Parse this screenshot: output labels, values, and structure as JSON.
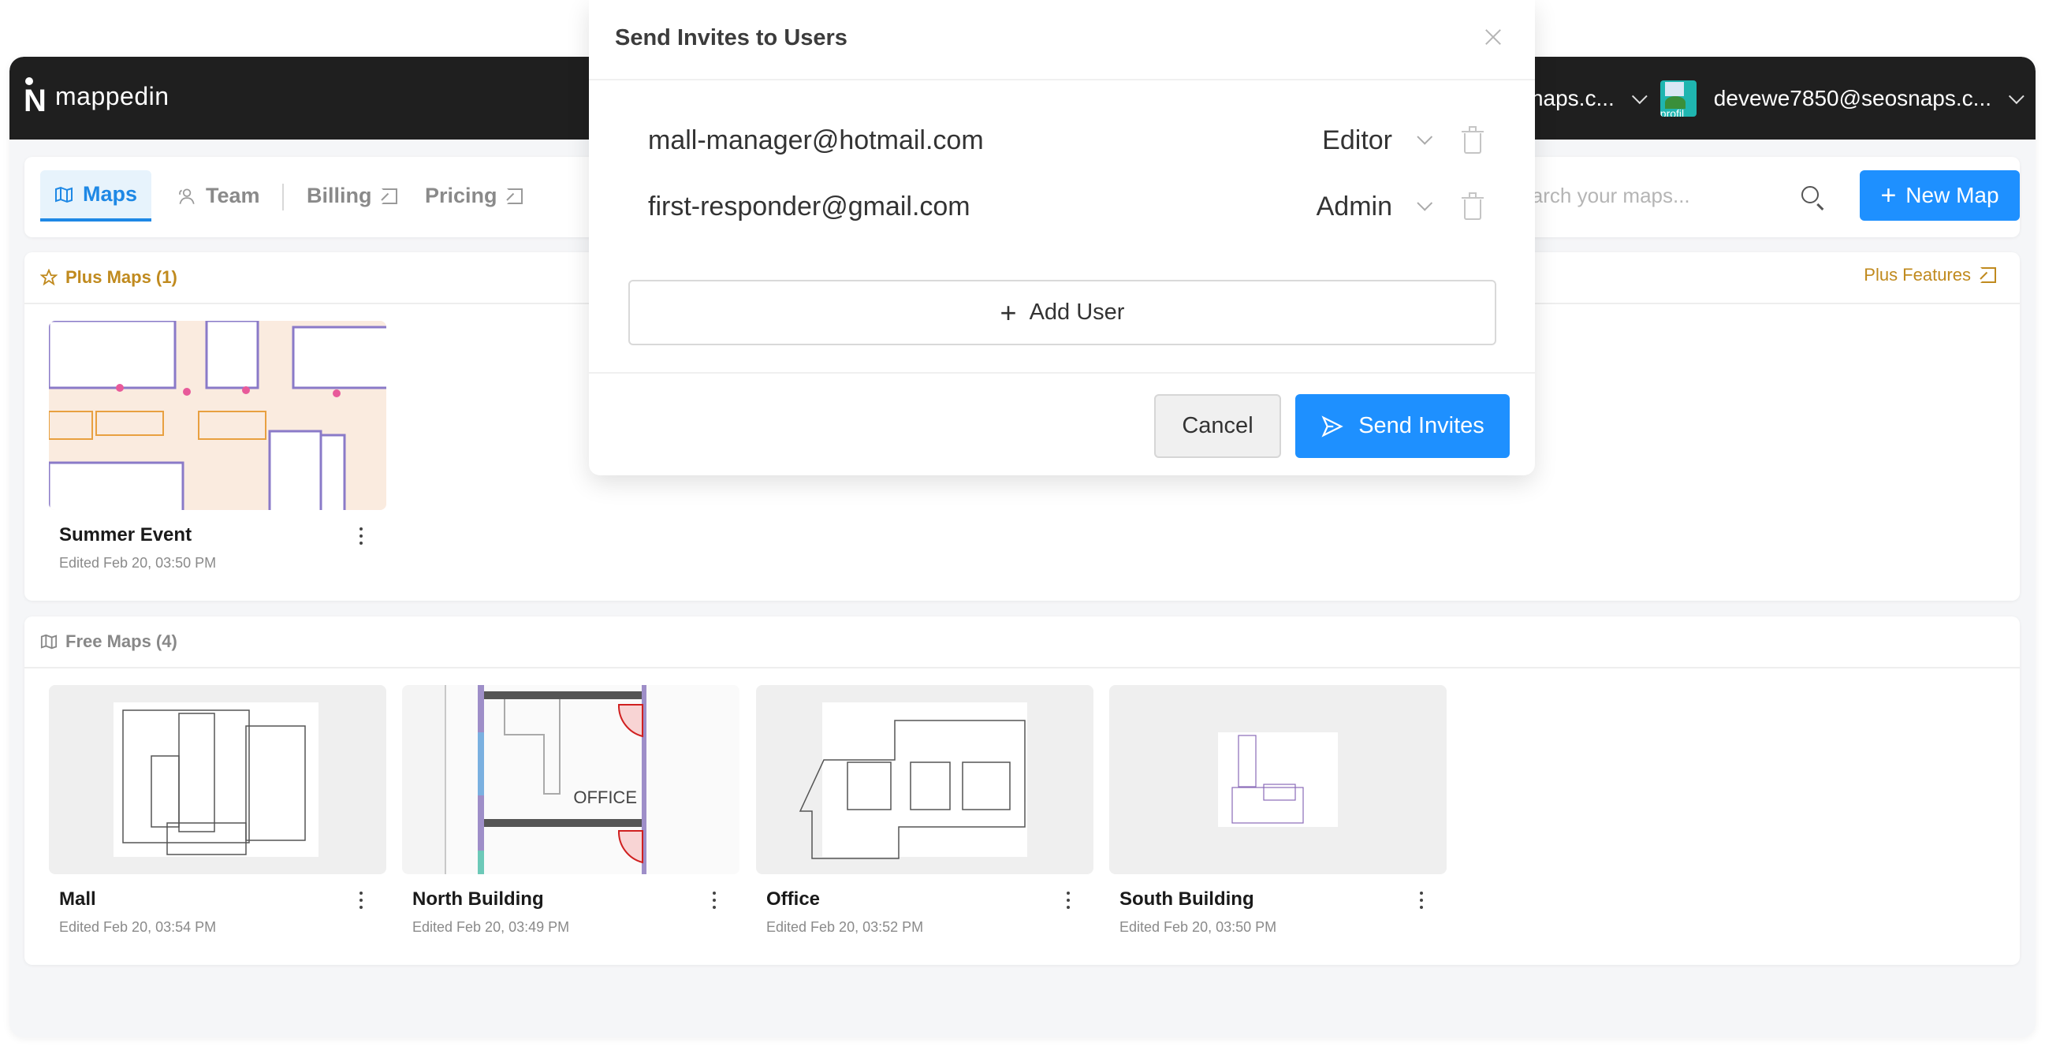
{
  "app": {
    "name": "mappedin"
  },
  "navbar": {
    "org_label": "devewe7850@seosnaps.c...",
    "org_label_visible": "osnaps.c...",
    "user_avatar_text": "profil",
    "user_label": "devewe7850@seosnaps.c..."
  },
  "tabs": [
    {
      "label": "Maps",
      "icon": "map-icon",
      "active": true
    },
    {
      "label": "Team",
      "icon": "user-icon",
      "active": false
    },
    {
      "label": "Billing",
      "icon": "external-link-icon",
      "active": false
    },
    {
      "label": "Pricing",
      "icon": "external-link-icon",
      "active": false
    }
  ],
  "search": {
    "placeholder": "Search your maps...",
    "value": ""
  },
  "new_map_label": "New Map",
  "plus_section": {
    "title": "Plus Maps (1)",
    "features_link": "Plus Features",
    "maps": [
      {
        "name": "Summer Event",
        "edited": "Edited Feb 20, 03:50 PM"
      }
    ]
  },
  "free_section": {
    "title": "Free Maps (4)",
    "maps": [
      {
        "name": "Mall",
        "edited": "Edited Feb 20, 03:54 PM"
      },
      {
        "name": "North Building",
        "edited": "Edited Feb 20, 03:49 PM",
        "thumb_label": "OFFICE"
      },
      {
        "name": "Office",
        "edited": "Edited Feb 20, 03:52 PM"
      },
      {
        "name": "South Building",
        "edited": "Edited Feb 20, 03:50 PM"
      }
    ]
  },
  "modal": {
    "title": "Send Invites to Users",
    "invites": [
      {
        "email": "mall-manager@hotmail.com",
        "role": "Editor"
      },
      {
        "email": "first-responder@gmail.com",
        "role": "Admin"
      }
    ],
    "add_user_label": "Add User",
    "cancel_label": "Cancel",
    "send_label": "Send Invites"
  },
  "colors": {
    "accent": "#1e90ff",
    "plus": "#c08a1e",
    "navbar": "#1f1f1f"
  }
}
